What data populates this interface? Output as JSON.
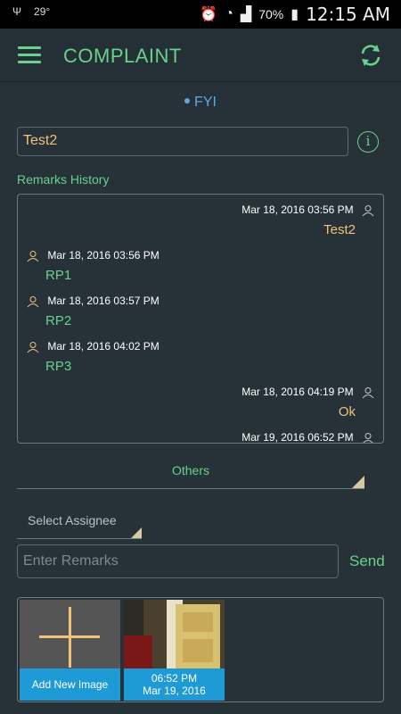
{
  "statusbar": {
    "temperature": "29°",
    "battery": "70%",
    "time": "12:15 AM"
  },
  "appbar": {
    "title": "COMPLAINT",
    "menu_icon": "hamburger-menu-icon",
    "refresh_icon": "refresh-icon"
  },
  "status_tag": "FYI",
  "subject": {
    "value": "Test2",
    "info_icon": "info-icon"
  },
  "remarks_history": {
    "label": "Remarks History",
    "messages": [
      {
        "side": "right",
        "timestamp": "Mar 18, 2016 03:56 PM",
        "text": "Test2"
      },
      {
        "side": "left",
        "timestamp": "Mar 18, 2016 03:56 PM",
        "text": "RP1"
      },
      {
        "side": "left",
        "timestamp": "Mar 18, 2016 03:57 PM",
        "text": "RP2"
      },
      {
        "side": "left",
        "timestamp": "Mar 18, 2016 04:02 PM",
        "text": "RP3"
      },
      {
        "side": "right",
        "timestamp": "Mar 18, 2016 04:19 PM",
        "text": "Ok"
      },
      {
        "side": "right",
        "timestamp": "Mar 19, 2016 06:52 PM",
        "text": ""
      }
    ]
  },
  "others_dropdown": {
    "selected": "Others"
  },
  "assignee_dropdown": {
    "placeholder": "Select Assignee"
  },
  "remarks_input": {
    "placeholder": "Enter Remarks"
  },
  "send_label": "Send",
  "images": {
    "add_label": "Add New Image",
    "photo_time": "06:52 PM",
    "photo_date": "Mar 19, 2016"
  },
  "colors": {
    "accent_green": "#69d18c",
    "accent_orange": "#f2c27c",
    "accent_blue": "#1e9ad6",
    "background": "#263238"
  }
}
